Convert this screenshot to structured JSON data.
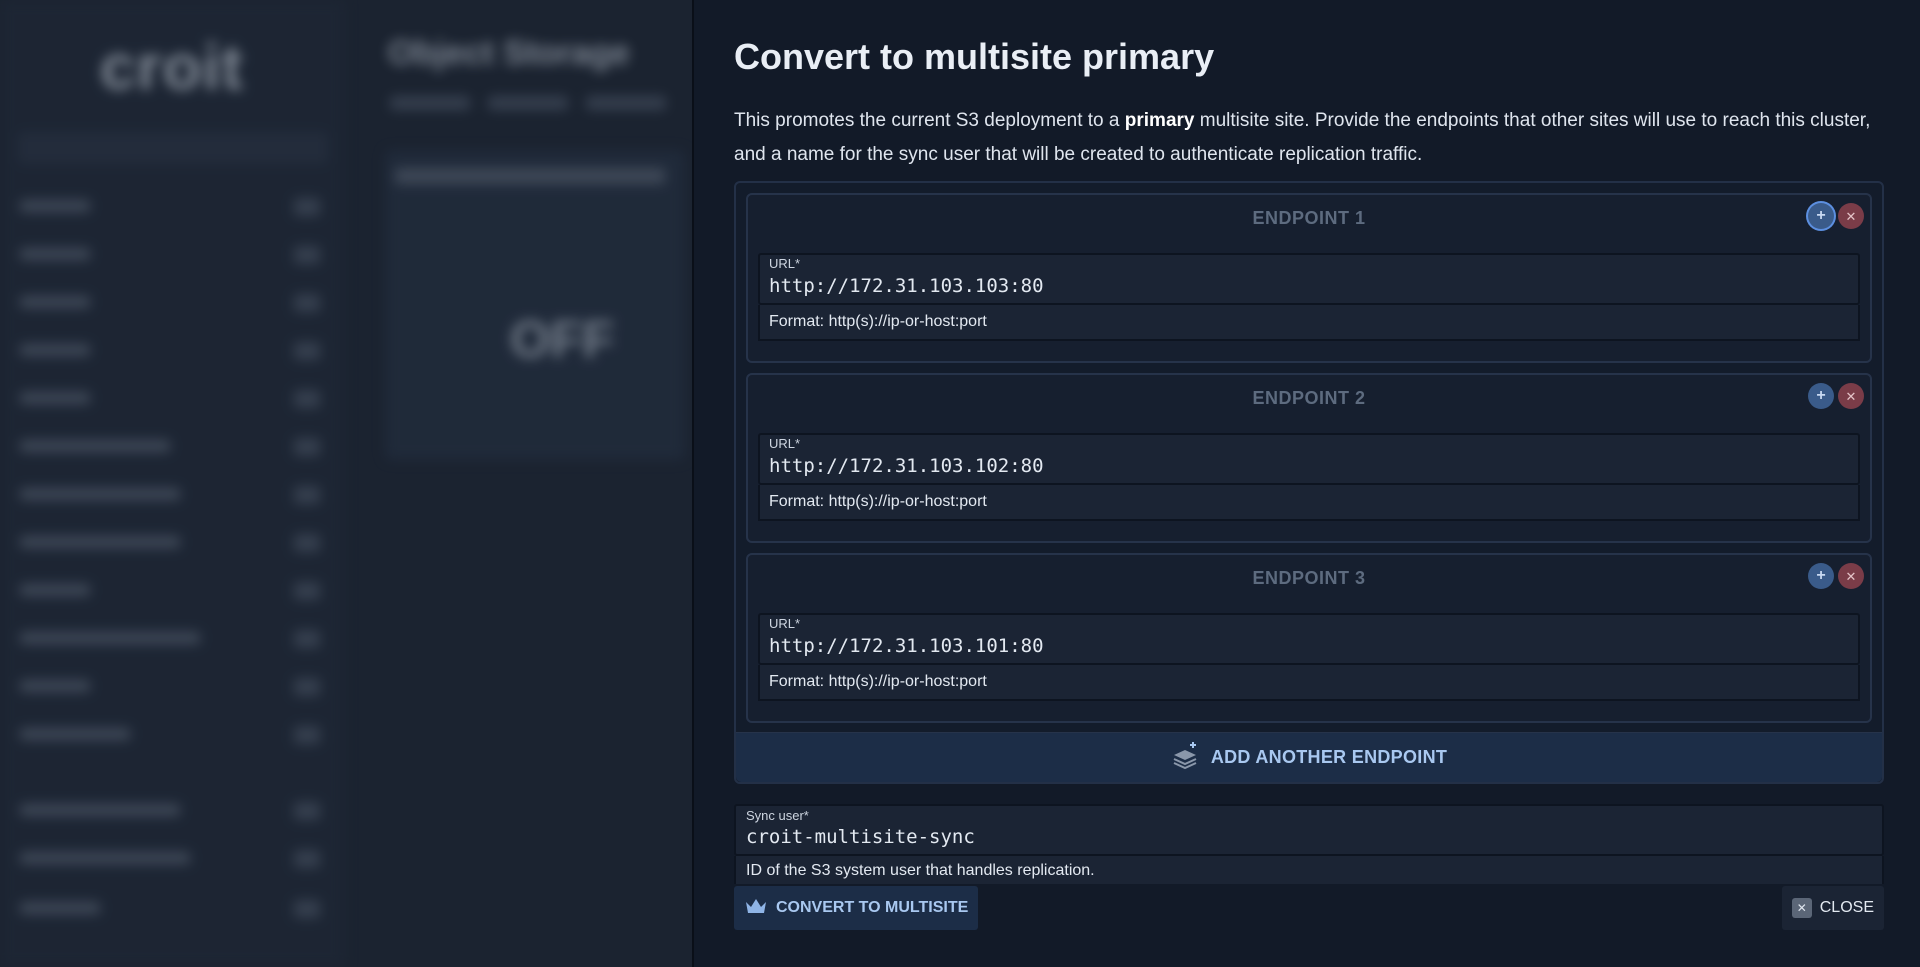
{
  "background": {
    "logo": "croit",
    "page_title": "Object Storage",
    "card_value": "OFF"
  },
  "dialog": {
    "title": "Convert to multisite primary",
    "description_before": "This promotes the current S3 deployment to a ",
    "description_bold": "primary",
    "description_after": " multisite site. Provide the endpoints that other sites will use to reach this cluster, and a name for the sync user that will be created to authenticate replication traffic.",
    "endpoints": [
      {
        "heading": "ENDPOINT 1",
        "url_label": "URL*",
        "url_value": "http://172.31.103.103:80",
        "hint": "Format: http(s)://ip-or-host:port"
      },
      {
        "heading": "ENDPOINT 2",
        "url_label": "URL*",
        "url_value": "http://172.31.103.102:80",
        "hint": "Format: http(s)://ip-or-host:port"
      },
      {
        "heading": "ENDPOINT 3",
        "url_label": "URL*",
        "url_value": "http://172.31.103.101:80",
        "hint": "Format: http(s)://ip-or-host:port"
      }
    ],
    "add_endpoint_label": "ADD ANOTHER ENDPOINT",
    "sync_user": {
      "label": "Sync user*",
      "value": "croit-multisite-sync",
      "hint": "ID of the S3 system user that handles replication."
    },
    "convert_label": "CONVERT TO MULTISITE",
    "close_label": "CLOSE"
  },
  "icons": {
    "add": "plus-icon",
    "remove": "close-icon",
    "add_endpoint": "layers-plus-icon",
    "convert": "crown-icon",
    "close": "close-icon"
  },
  "colors": {
    "accent": "#a9c8f0",
    "panel_bg": "#121a28",
    "remove": "#7a3c48",
    "add": "#3a5b8a"
  }
}
